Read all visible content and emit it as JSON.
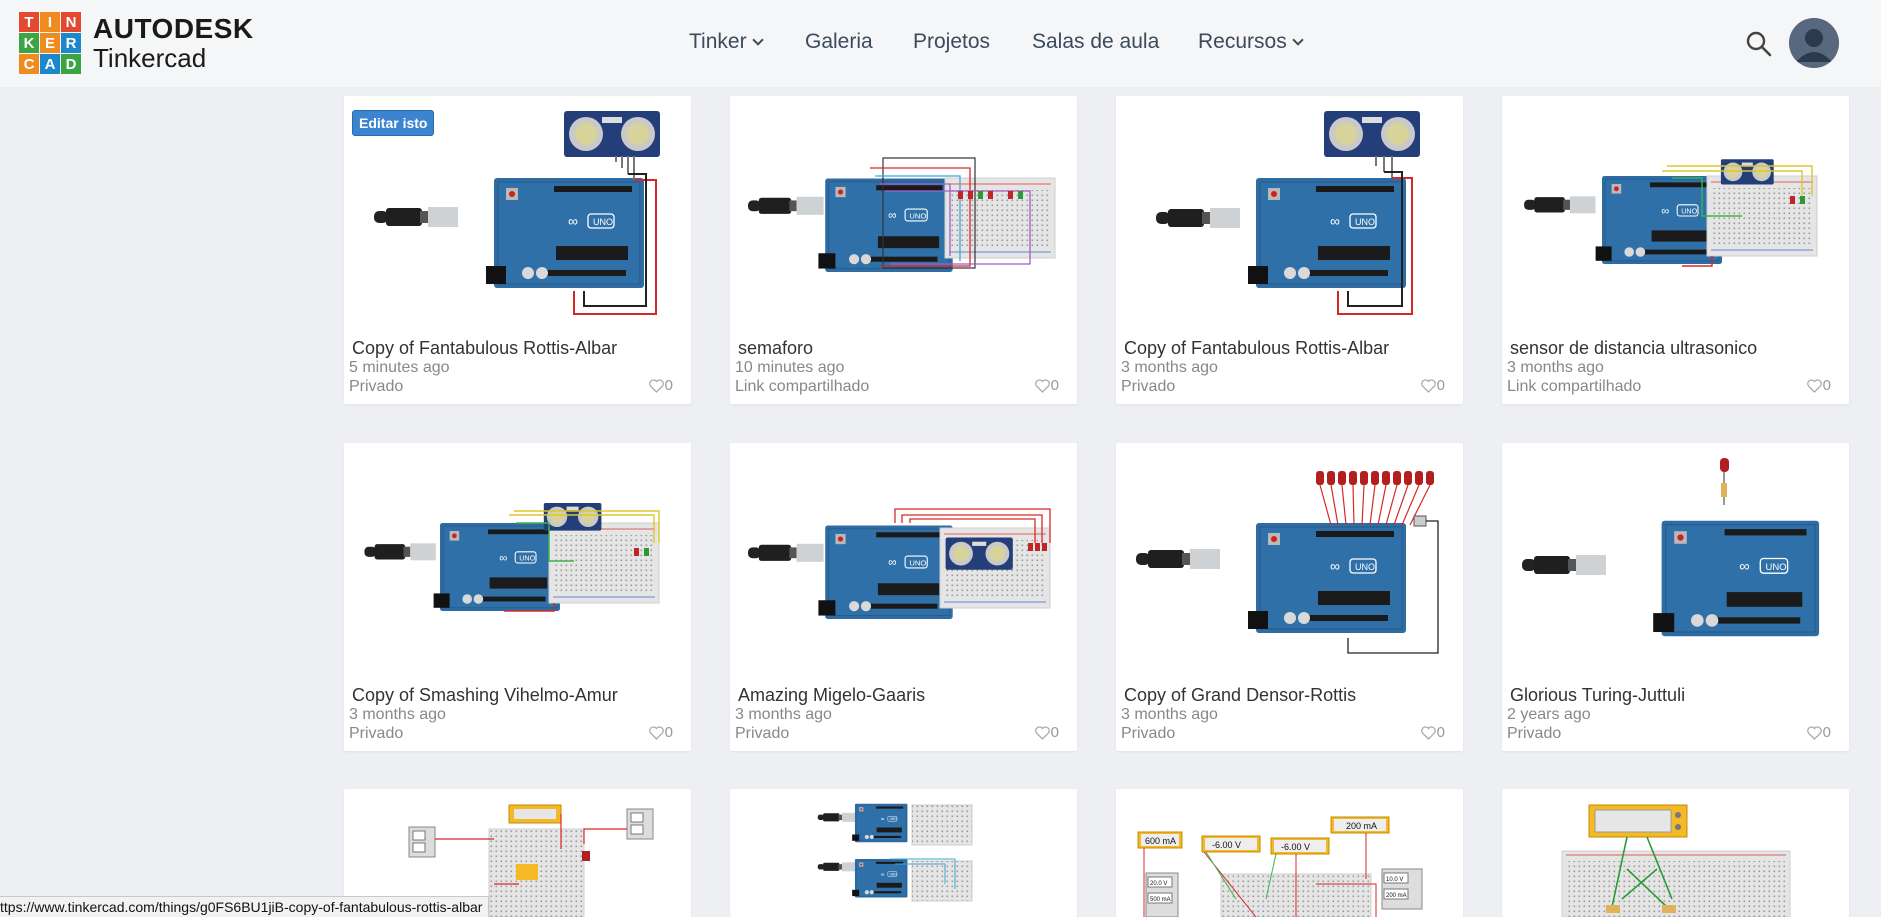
{
  "header": {
    "logo_letters": [
      "T",
      "I",
      "N",
      "K",
      "E",
      "R",
      "C",
      "A",
      "D"
    ],
    "logo_colors": [
      "#e2492f",
      "#f08c1f",
      "#e2492f",
      "#3ba544",
      "#f08c1f",
      "#1d88c9",
      "#f08c1f",
      "#1d88c9",
      "#3ba544"
    ],
    "brand": "AUTODESK",
    "product": "Tinkercad",
    "nav": [
      {
        "label": "Tinker",
        "has_dropdown": true
      },
      {
        "label": "Galeria",
        "has_dropdown": false
      },
      {
        "label": "Projetos",
        "has_dropdown": false
      },
      {
        "label": "Salas de aula",
        "has_dropdown": false
      },
      {
        "label": "Recursos",
        "has_dropdown": true
      }
    ],
    "search_icon": "search-icon",
    "avatar_icon": "user-avatar"
  },
  "cards": [
    {
      "title": "Copy of Fantabulous Rottis-Albar",
      "time": "5 minutes ago",
      "privacy": "Privado",
      "likes": "0",
      "edit_label": "Editar isto"
    },
    {
      "title": "semaforo",
      "time": "10 minutes ago",
      "privacy": "Link compartilhado",
      "likes": "0"
    },
    {
      "title": "Copy of Fantabulous Rottis-Albar",
      "time": "3 months ago",
      "privacy": "Privado",
      "likes": "0"
    },
    {
      "title": "sensor de distancia ultrasonico",
      "time": "3 months ago",
      "privacy": "Link compartilhado",
      "likes": "0"
    },
    {
      "title": "Copy of Smashing Vihelmo-Amur",
      "time": "3 months ago",
      "privacy": "Privado",
      "likes": "0"
    },
    {
      "title": "Amazing Migelo-Gaaris",
      "time": "3 months ago",
      "privacy": "Privado",
      "likes": "0"
    },
    {
      "title": "Copy of Grand Densor-Rottis",
      "time": "3 months ago",
      "privacy": "Privado",
      "likes": "0"
    },
    {
      "title": "Glorious Turing-Juttuli",
      "time": "2 years ago",
      "privacy": "Privado",
      "likes": "0"
    }
  ],
  "thumb_labels": {
    "meter_1": "600 mA",
    "meter_2": "-6.00 V",
    "meter_3": "-6.00 V",
    "meter_4": "200 mA",
    "meter_5": "10.0 V",
    "meter_6": "200 mA",
    "meter_7": "20.0 V",
    "meter_8": "500 mA"
  },
  "status_url": "ttps://www.tinkercad.com/things/g0FS6BU1jiB-copy-of-fantabulous-rottis-albar",
  "colors": {
    "page_bg": "#edeff2",
    "header_bg": "#f5f6f7",
    "edit_button": "#3c84cf",
    "arduino_blue": "#2f6fa4",
    "wire_red": "#d62828"
  }
}
